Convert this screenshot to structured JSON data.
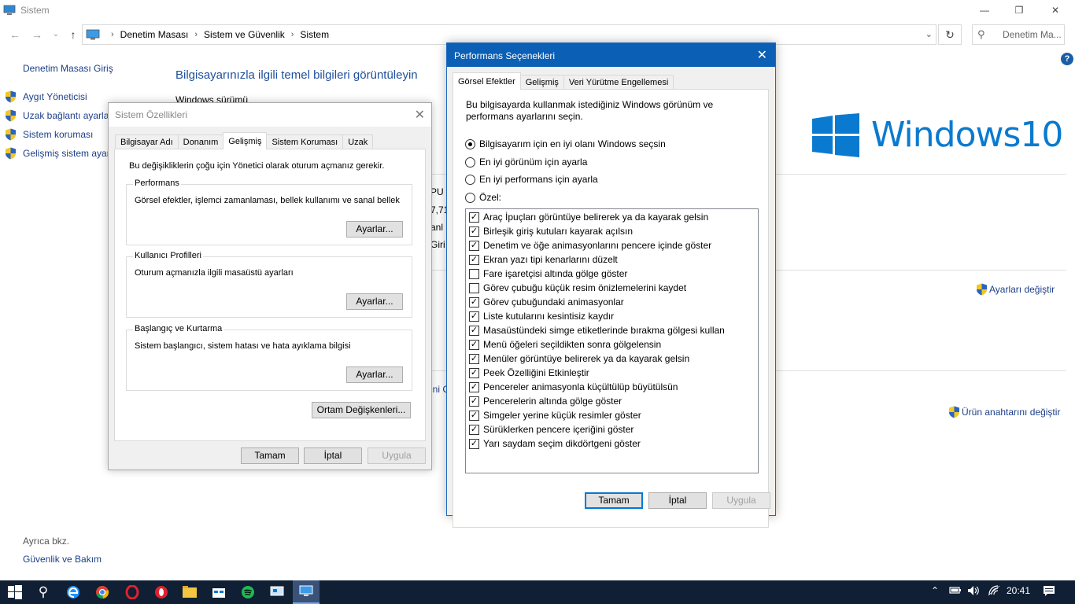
{
  "window": {
    "title": "Sistem",
    "minimize": "—",
    "maximize": "❐",
    "close": "✕"
  },
  "nav": {
    "back": "←",
    "forward": "→",
    "recent": "⌄",
    "up": "↑"
  },
  "breadcrumb": [
    "Denetim Masası",
    "Sistem ve Güvenlik",
    "Sistem"
  ],
  "breadcrumb_sep": "›",
  "search": {
    "placeholder": "Denetim Ma..."
  },
  "help": "?",
  "left_pane": {
    "home": "Denetim Masası Giriş",
    "items": [
      "Aygıt Yöneticisi",
      "Uzak bağlantı ayarları",
      "Sistem koruması",
      "Gelişmiş sistem ayarları"
    ],
    "see_also_label": "Ayrıca bkz.",
    "see_also_link": "Güvenlik ve Bakım"
  },
  "main": {
    "heading": "Bilgisayarınızla ilgili temel bilgileri görüntüleyin",
    "edition_label": "Windows sürümü",
    "partial_texts": [
      "PU",
      "7,71",
      "anl",
      "Giri",
      "ini C"
    ],
    "logo_text": "Windows10",
    "change_settings": "Ayarları değiştir",
    "change_product_key": "Ürün anahtarını değiştir"
  },
  "system_properties": {
    "title": "Sistem Özellikleri",
    "tabs": [
      "Bilgisayar Adı",
      "Donanım",
      "Gelişmiş",
      "Sistem Koruması",
      "Uzak"
    ],
    "active_tab": "Gelişmiş",
    "notice": "Bu değişikliklerin çoğu için Yönetici olarak oturum açmanız gerekir.",
    "groups": [
      {
        "label": "Performans",
        "desc": "Görsel efektler, işlemci zamanlaması, bellek kullanımı ve sanal bellek",
        "button": "Ayarlar..."
      },
      {
        "label": "Kullanıcı Profilleri",
        "desc": "Oturum açmanızla ilgili masaüstü ayarları",
        "button": "Ayarlar..."
      },
      {
        "label": "Başlangıç ve Kurtarma",
        "desc": "Sistem başlangıcı, sistem hatası ve hata ayıklama bilgisi",
        "button": "Ayarlar..."
      }
    ],
    "env_button": "Ortam Değişkenleri...",
    "ok": "Tamam",
    "cancel": "İptal",
    "apply": "Uygula"
  },
  "performance_options": {
    "title": "Performans Seçenekleri",
    "tabs": [
      "Görsel Efektler",
      "Gelişmiş",
      "Veri Yürütme Engellemesi"
    ],
    "active_tab": "Görsel Efektler",
    "intro": "Bu bilgisayarda kullanmak istediğiniz Windows görünüm ve performans ayarlarını seçin.",
    "radios": [
      {
        "label": "Bilgisayarım için en iyi olanı Windows seçsin",
        "selected": true
      },
      {
        "label": "En iyi görünüm için ayarla",
        "selected": false
      },
      {
        "label": "En iyi performans için ayarla",
        "selected": false
      },
      {
        "label": "Özel:",
        "selected": false
      }
    ],
    "effects": [
      {
        "label": "Araç İpuçları görüntüye belirerek ya da kayarak gelsin",
        "checked": true
      },
      {
        "label": "Birleşik giriş kutuları kayarak açılsın",
        "checked": true
      },
      {
        "label": "Denetim ve öğe animasyonlarını pencere içinde göster",
        "checked": true
      },
      {
        "label": "Ekran yazı tipi kenarlarını düzelt",
        "checked": true
      },
      {
        "label": "Fare işaretçisi altında gölge göster",
        "checked": false
      },
      {
        "label": "Görev çubuğu küçük resim önizlemelerini kaydet",
        "checked": false
      },
      {
        "label": "Görev çubuğundaki animasyonlar",
        "checked": true
      },
      {
        "label": "Liste kutularını kesintisiz kaydır",
        "checked": true
      },
      {
        "label": "Masaüstündeki simge etiketlerinde bırakma gölgesi kullan",
        "checked": true
      },
      {
        "label": "Menü öğeleri seçildikten sonra gölgelensin",
        "checked": true
      },
      {
        "label": "Menüler görüntüye belirerek ya da kayarak gelsin",
        "checked": true
      },
      {
        "label": "Peek Özelliğini Etkinleştir",
        "checked": true
      },
      {
        "label": "Pencereler animasyonla küçültülüp büyütülsün",
        "checked": true
      },
      {
        "label": "Pencerelerin altında gölge göster",
        "checked": true
      },
      {
        "label": "Simgeler yerine küçük resimler göster",
        "checked": true
      },
      {
        "label": "Sürüklerken pencere içeriğini göster",
        "checked": true
      },
      {
        "label": "Yarı saydam seçim dikdörtgeni göster",
        "checked": true
      }
    ],
    "ok": "Tamam",
    "cancel": "İptal",
    "apply": "Uygula"
  },
  "taskbar": {
    "apps": [
      "start-icon",
      "search-icon",
      "edge-icon",
      "chrome-icon",
      "opera-icon",
      "opera-gx-icon",
      "file-explorer-icon",
      "store-icon",
      "discord-icon",
      "spotify-icon",
      "remote-desktop-icon",
      "system-icon"
    ],
    "tray_chevron": "⌃",
    "clock": "20:41",
    "accent": "#0078d7"
  }
}
